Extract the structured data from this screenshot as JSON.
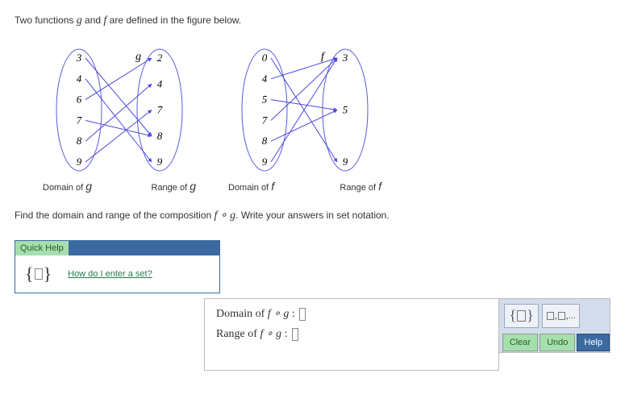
{
  "intro_prefix": "Two functions ",
  "g_letter": "g",
  "intro_mid": " and ",
  "f_letter": "f",
  "intro_suffix": " are defined in the figure below.",
  "mapping_g": {
    "letter": "g",
    "domain": [
      3,
      4,
      6,
      7,
      8,
      9
    ],
    "range": [
      2,
      4,
      7,
      8,
      9
    ],
    "arrows": [
      [
        3,
        8
      ],
      [
        4,
        9
      ],
      [
        6,
        2
      ],
      [
        7,
        8
      ],
      [
        8,
        4
      ],
      [
        9,
        7
      ]
    ],
    "domain_label_prefix": "Domain of ",
    "range_label_prefix": "Range of "
  },
  "mapping_f": {
    "letter": "f",
    "domain": [
      0,
      4,
      5,
      7,
      8,
      9
    ],
    "range": [
      3,
      5,
      9
    ],
    "arrows": [
      [
        0,
        9
      ],
      [
        4,
        3
      ],
      [
        5,
        5
      ],
      [
        7,
        3
      ],
      [
        8,
        5
      ],
      [
        9,
        3
      ]
    ],
    "domain_label_prefix": "Domain of ",
    "range_label_prefix": "Range of "
  },
  "prompt_prefix": "Find the domain and range of the composition ",
  "compose_expr": "f ∘ g",
  "prompt_suffix": ". Write your answers in set notation.",
  "quickhelp": {
    "tab": "Quick Help",
    "link_text": "How do I enter a set?"
  },
  "answers": {
    "domain_label_prefix": "Domain of ",
    "range_label_prefix": "Range of ",
    "compose_display": "f ∘ g",
    "colon": " :"
  },
  "palette": {
    "brace_tooltip": "set braces",
    "list_tooltip": "list with commas",
    "clear": "Clear",
    "undo": "Undo",
    "help": "Help"
  },
  "colors": {
    "arrow": "#4a4ae0",
    "ellipse_stroke": "#5a5ae0",
    "text": "#333"
  }
}
